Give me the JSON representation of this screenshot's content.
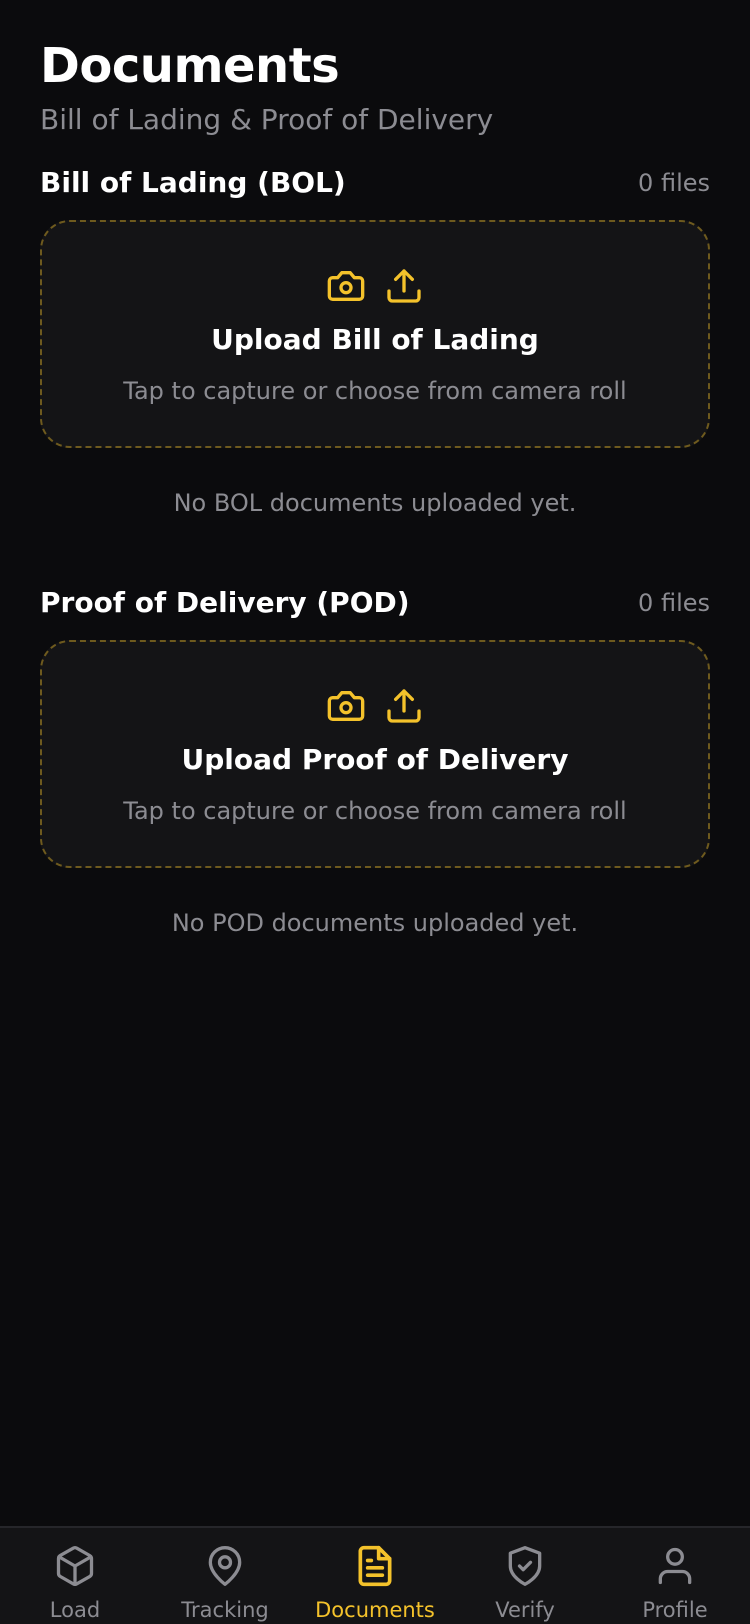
{
  "header": {
    "title": "Documents",
    "subtitle": "Bill of Lading & Proof of Delivery"
  },
  "sections": [
    {
      "title": "Bill of Lading (BOL)",
      "count": "0 files",
      "upload_title": "Upload Bill of Lading",
      "upload_hint": "Tap to capture or choose from camera roll",
      "empty_text": "No BOL documents uploaded yet.",
      "icons": [
        "camera-icon",
        "upload-icon"
      ]
    },
    {
      "title": "Proof of Delivery (POD)",
      "count": "0 files",
      "upload_title": "Upload Proof of Delivery",
      "upload_hint": "Tap to capture or choose from camera roll",
      "empty_text": "No POD documents uploaded yet.",
      "icons": [
        "camera-icon",
        "upload-icon"
      ]
    }
  ],
  "tabbar": {
    "active": "Documents",
    "items": [
      {
        "label": "Load",
        "icon": "package-icon"
      },
      {
        "label": "Tracking",
        "icon": "map-pin-icon"
      },
      {
        "label": "Documents",
        "icon": "document-icon"
      },
      {
        "label": "Verify",
        "icon": "shield-check-icon"
      },
      {
        "label": "Profile",
        "icon": "user-icon"
      }
    ]
  },
  "colors": {
    "background": "#0b0b0d",
    "card": "#141416",
    "accent": "#f4c22b",
    "muted_text": "#8c8c92",
    "dashed_border": "#6e5a1e"
  }
}
